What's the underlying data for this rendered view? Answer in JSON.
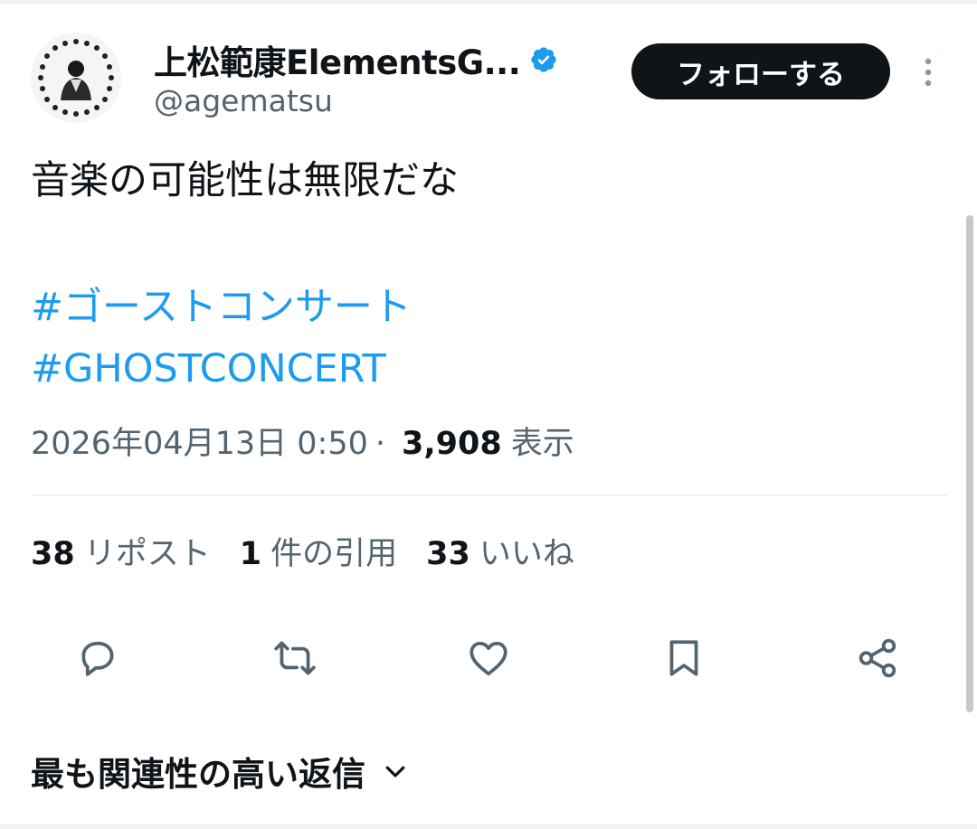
{
  "author": {
    "display_name": "上松範康ElementsG...",
    "handle": "@agematsu",
    "verified": true
  },
  "follow_label": "フォローする",
  "tweet": {
    "text": "音楽の可能性は無限だな",
    "hashtags": [
      "#ゴーストコンサート",
      "#GHOSTCONCERT"
    ],
    "timestamp": "2026年04月13日 0:50",
    "separator": "·",
    "views": "3,908",
    "views_label": "表示"
  },
  "stats": {
    "reposts": {
      "count": "38",
      "label": "リポスト"
    },
    "quotes": {
      "count": "1",
      "label": "件の引用"
    },
    "likes": {
      "count": "33",
      "label": "いいね"
    }
  },
  "actions": [
    "reply-icon",
    "repost-icon",
    "like-icon",
    "bookmark-icon",
    "share-icon"
  ],
  "sort_label": "最も関連性の高い返信",
  "colors": {
    "text": "#0f1419",
    "secondary": "#536471",
    "link": "#1d9bf0",
    "verified": "#1d9bf0",
    "follow_bg": "#0f1419",
    "follow_text": "#ffffff",
    "divider": "#eff3f4"
  }
}
